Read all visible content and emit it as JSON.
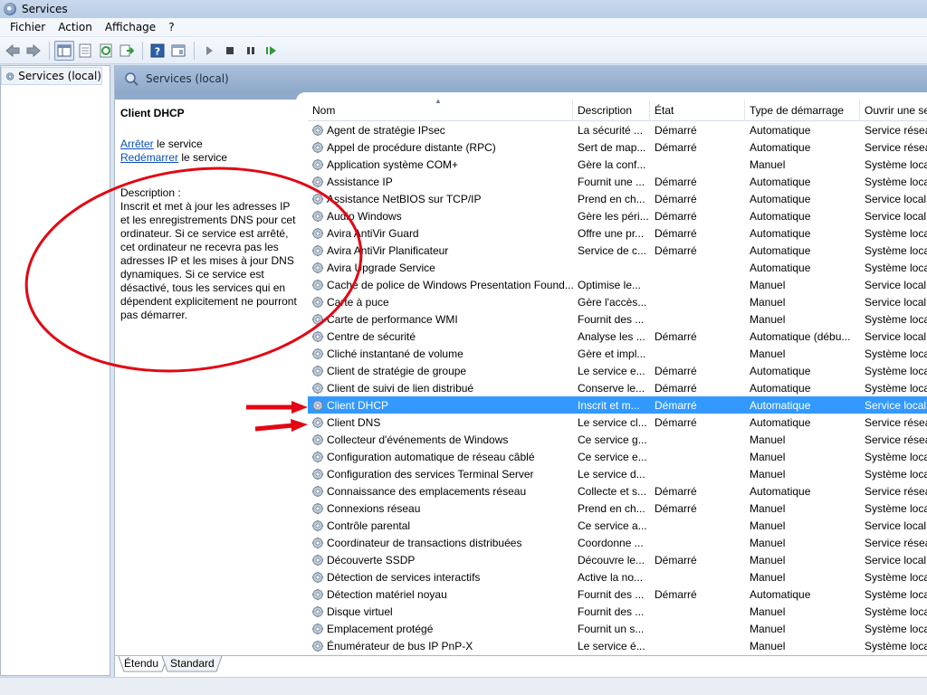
{
  "window": {
    "title": "Services"
  },
  "menu": [
    "Fichier",
    "Action",
    "Affichage",
    "?"
  ],
  "toolbar": {
    "icons": [
      "back-arrow-icon",
      "forward-arrow-icon",
      "console-tree-icon",
      "properties-icon",
      "refresh-icon",
      "export-list-icon",
      "help-icon",
      "mmc-view-icon",
      "start-service-icon",
      "stop-service-icon",
      "pause-service-icon",
      "restart-service-icon"
    ]
  },
  "tree": {
    "root_label": "Services (local)"
  },
  "pane_header": {
    "label": "Services (local)"
  },
  "detail": {
    "service_name": "Client DHCP",
    "stop_link": "Arrêter",
    "stop_suffix": " le service",
    "restart_link": "Redémarrer",
    "restart_suffix": " le service",
    "description_title": "Description :",
    "description_text": "Inscrit et met à jour les adresses IP et les enregistrements DNS pour cet ordinateur. Si ce service est arrêté, cet ordinateur ne recevra pas les adresses IP et les mises à jour DNS dynamiques. Si ce service est désactivé, tous les services qui en dépendent explicitement ne pourront pas démarrer."
  },
  "columns": [
    "Nom",
    "Description",
    "État",
    "Type de démarrage",
    "Ouvrir une se"
  ],
  "rows": [
    [
      "Agent de stratégie IPsec",
      "La sécurité ...",
      "Démarré",
      "Automatique",
      "Service réseau"
    ],
    [
      "Appel de procédure distante (RPC)",
      "Sert de map...",
      "Démarré",
      "Automatique",
      "Service réseau"
    ],
    [
      "Application système COM+",
      "Gère la conf...",
      "",
      "Manuel",
      "Système local"
    ],
    [
      "Assistance IP",
      "Fournit une ...",
      "Démarré",
      "Automatique",
      "Système local"
    ],
    [
      "Assistance NetBIOS sur TCP/IP",
      "Prend en ch...",
      "Démarré",
      "Automatique",
      "Service local"
    ],
    [
      "Audio Windows",
      "Gère les péri...",
      "Démarré",
      "Automatique",
      "Service local"
    ],
    [
      "Avira AntiVir Guard",
      "Offre une pr...",
      "Démarré",
      "Automatique",
      "Système local"
    ],
    [
      "Avira AntiVir Planificateur",
      "Service de c...",
      "Démarré",
      "Automatique",
      "Système local"
    ],
    [
      "Avira Upgrade Service",
      "",
      "",
      "Automatique",
      "Système local"
    ],
    [
      "Cache de police de Windows Presentation Found...",
      "Optimise le...",
      "",
      "Manuel",
      "Service local"
    ],
    [
      "Carte à puce",
      "Gère l'accès...",
      "",
      "Manuel",
      "Service local"
    ],
    [
      "Carte de performance WMI",
      "Fournit des ...",
      "",
      "Manuel",
      "Système local"
    ],
    [
      "Centre de sécurité",
      "Analyse les ...",
      "Démarré",
      "Automatique (débu...",
      "Service local"
    ],
    [
      "Cliché instantané de volume",
      "Gère et impl...",
      "",
      "Manuel",
      "Système local"
    ],
    [
      "Client de stratégie de groupe",
      "Le service e...",
      "Démarré",
      "Automatique",
      "Système local"
    ],
    [
      "Client de suivi de lien distribué",
      "Conserve le...",
      "Démarré",
      "Automatique",
      "Système local"
    ],
    [
      "Client DHCP",
      "Inscrit et m...",
      "Démarré",
      "Automatique",
      "Service local"
    ],
    [
      "Client DNS",
      "Le service cl...",
      "Démarré",
      "Automatique",
      "Service réseau"
    ],
    [
      "Collecteur d'événements de Windows",
      "Ce service g...",
      "",
      "Manuel",
      "Service réseau"
    ],
    [
      "Configuration automatique de réseau câblé",
      "Ce service e...",
      "",
      "Manuel",
      "Système local"
    ],
    [
      "Configuration des services Terminal Server",
      "Le service d...",
      "",
      "Manuel",
      "Système local"
    ],
    [
      "Connaissance des emplacements réseau",
      "Collecte et s...",
      "Démarré",
      "Automatique",
      "Service réseau"
    ],
    [
      "Connexions réseau",
      "Prend en ch...",
      "Démarré",
      "Manuel",
      "Système local"
    ],
    [
      "Contrôle parental",
      "Ce service a...",
      "",
      "Manuel",
      "Service local"
    ],
    [
      "Coordinateur de transactions distribuées",
      "Coordonne ...",
      "",
      "Manuel",
      "Service réseau"
    ],
    [
      "Découverte SSDP",
      "Découvre le...",
      "Démarré",
      "Manuel",
      "Service local"
    ],
    [
      "Détection de services interactifs",
      "Active la no...",
      "",
      "Manuel",
      "Système local"
    ],
    [
      "Détection matériel noyau",
      "Fournit des ...",
      "Démarré",
      "Automatique",
      "Système local"
    ],
    [
      "Disque virtuel",
      "Fournit des ...",
      "",
      "Manuel",
      "Système local"
    ],
    [
      "Emplacement protégé",
      "Fournit un s...",
      "",
      "Manuel",
      "Système local"
    ],
    [
      "Énumérateur de bus IP PnP-X",
      "Le service é...",
      "",
      "Manuel",
      "Système local"
    ]
  ],
  "selected_row": "Client DHCP",
  "tabs": [
    "Étendu",
    "Standard"
  ],
  "colors": {
    "selection": "#3399ff",
    "annotation": "#e30613",
    "link": "#0b4fb3"
  }
}
